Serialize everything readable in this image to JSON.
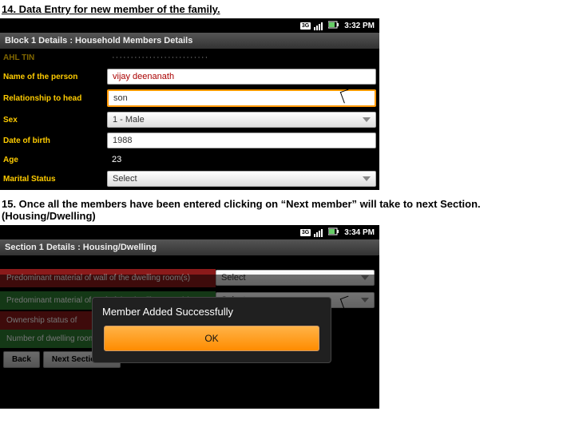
{
  "captions": {
    "c1": "14. Data Entry for new member of the family.",
    "c2": "15. Once all the members have been entered clicking on “Next member” will take to next Section. (Housing/Dwelling)"
  },
  "screen1": {
    "time": "3:32 PM",
    "title": "Block 1 Details : Household Members Details",
    "labels": {
      "ahl": "AHL TIN",
      "name": "Name of the person",
      "rel": "Relationship to head",
      "sex": "Sex",
      "dob": "Date of birth",
      "age": "Age",
      "marital": "Marital Status"
    },
    "values": {
      "name": "vijay deenanath",
      "rel": "son",
      "sex": "1 - Male",
      "dob": "1988",
      "age": "23",
      "marital": "Select"
    },
    "icons": {
      "3g": "3G"
    }
  },
  "screen2": {
    "time": "3:34 PM",
    "title": "Section 1 Details : Housing/Dwelling",
    "labels": {
      "wall": "Predominant material of wall of the dwelling room(s)",
      "roof": "Predominant material of roof of the dwelling room(s)",
      "ownership": "Ownership status of",
      "rooms": "Number of dwelling rooms exclus… of this household"
    },
    "select": "Select",
    "dialog": {
      "title": "Member Added Successfully",
      "ok": "OK"
    },
    "buttons": {
      "back": "Back",
      "next": "Next Section >>"
    }
  }
}
